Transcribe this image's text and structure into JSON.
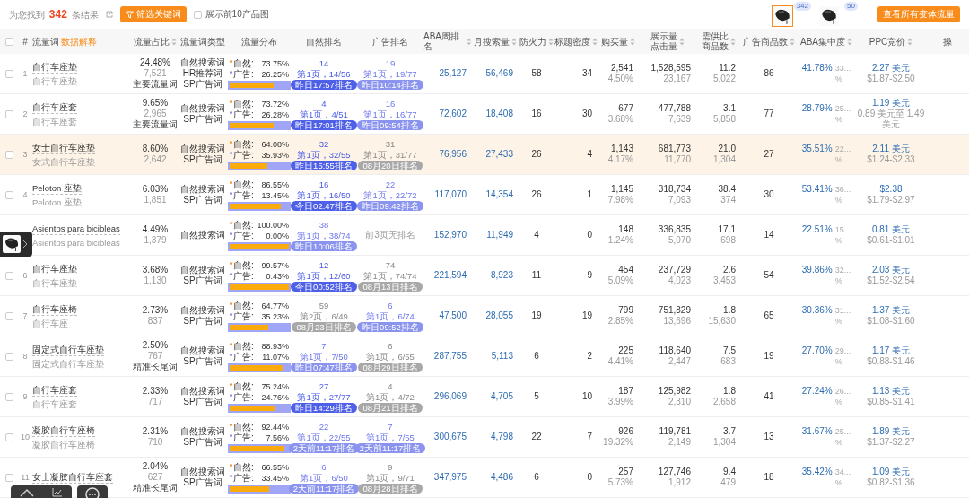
{
  "toolbar": {
    "result_text": "为您找到 **342** 条结果",
    "filter_button": "筛选关键词",
    "show_top10": {
      "label": "展示前10产品图",
      "checked": false
    },
    "variants": [
      {
        "count": "342",
        "selected": true
      },
      {
        "count": "50",
        "selected": false
      }
    ],
    "all_variants_button": "查看所有变体流量"
  },
  "table": {
    "select_all": {
      "checked": false
    },
    "columns": [
      {
        "lines": [
          "#"
        ],
        "sortable": false
      },
      {
        "lines": [
          "流量词"
        ],
        "sortable": false,
        "link": "数据解释"
      },
      {
        "lines": [
          "流量占比"
        ],
        "sortable": true
      },
      {
        "lines": [
          "流量词类型"
        ],
        "sortable": false
      },
      {
        "lines": [
          "流量分布"
        ],
        "sortable": false
      },
      {
        "lines": [
          "自然排名"
        ],
        "sortable": false
      },
      {
        "lines": [
          "广告排名"
        ],
        "sortable": false
      },
      {
        "lines": [
          "ABA周排名"
        ],
        "sortable": true
      },
      {
        "lines": [
          "月搜索量"
        ],
        "sortable": true
      },
      {
        "lines": [
          "防火力"
        ],
        "sortable": true
      },
      {
        "lines": [
          "标题密度"
        ],
        "sortable": true
      },
      {
        "lines": [
          "购买量"
        ],
        "sortable": true
      },
      {
        "lines": [
          "展示量",
          "点击量"
        ],
        "sortable": true
      },
      {
        "lines": [
          "需供比",
          "商品数"
        ],
        "sortable": true
      },
      {
        "lines": [
          "广告商品数"
        ],
        "sortable": true
      },
      {
        "lines": [
          "ABA集中度"
        ],
        "sortable": true
      },
      {
        "lines": [
          "PPC竞价"
        ],
        "sortable": true
      },
      {
        "lines": [
          "操"
        ],
        "sortable": false
      }
    ],
    "rows": [
      {
        "index": "1",
        "checked": false,
        "highlighted": false,
        "keyword": "自行车座垫",
        "translation": "自行车座垫",
        "share": "24.48%",
        "clicks": "7,521",
        "tag": "主要流量词",
        "types": [
          "自然搜索词",
          "HR推荐词",
          "SP广告词"
        ],
        "distribution": [
          {
            "label": "自然:",
            "value": "73.75%"
          },
          {
            "label": "广告:",
            "value": "26.25%"
          }
        ],
        "bar": {
          "level": 0.7375
        },
        "organic_rank": {
          "kind": "ranked",
          "fresh": true,
          "expired": false,
          "rank": "14",
          "page": "第1页，14/56",
          "time": "昨日17:57排名"
        },
        "ad_rank": {
          "kind": "ranked",
          "fresh": false,
          "expired": false,
          "rank": "19",
          "page": "第1页，19/77",
          "time": "昨日10:14排名"
        },
        "aba": "25,127",
        "monthly": "56,469",
        "fire": "58",
        "density": "34",
        "purchase": "2,541",
        "purchase_rate": "4.50%",
        "impressions": "1,528,595",
        "click_count": "23,167",
        "ratio": "11.2",
        "products": "5,022",
        "ad_products": "86",
        "concentration": "41.78%",
        "concentration_cut": "33...",
        "concentration_unit": "%",
        "ppc": "2.27 美元",
        "ppc_range": "$1.87-$2.50"
      },
      {
        "index": "2",
        "checked": false,
        "highlighted": false,
        "keyword": "自行车座套",
        "translation": "自行车座套",
        "share": "9.65%",
        "clicks": "2,965",
        "tag": "主要流量词",
        "types": [
          "自然搜索词",
          "SP广告词"
        ],
        "distribution": [
          {
            "label": "自然:",
            "value": "73.72%"
          },
          {
            "label": "广告:",
            "value": "26.28%"
          }
        ],
        "bar": {
          "level": 0.7372
        },
        "organic_rank": {
          "kind": "ranked",
          "fresh": true,
          "expired": false,
          "rank": "4",
          "page": "第1页，4/51",
          "time": "昨日17:01排名"
        },
        "ad_rank": {
          "kind": "ranked",
          "fresh": false,
          "expired": false,
          "rank": "16",
          "page": "第1页，16/77",
          "time": "昨日09:54排名"
        },
        "aba": "72,602",
        "monthly": "18,408",
        "fire": "16",
        "density": "30",
        "purchase": "677",
        "purchase_rate": "3.68%",
        "impressions": "477,788",
        "click_count": "7,639",
        "ratio": "3.1",
        "products": "5,858",
        "ad_products": "77",
        "concentration": "28.79%",
        "concentration_cut": "25...",
        "concentration_unit": "%",
        "ppc": "1.19 美元",
        "ppc_range": "0.89 美元至 1.49 美元"
      },
      {
        "index": "3",
        "checked": false,
        "highlighted": true,
        "keyword": "女士自行车座垫",
        "translation": "女式自行车座垫",
        "share": "8.60%",
        "clicks": "2,642",
        "types": [
          "自然搜索词",
          "SP广告词"
        ],
        "distribution": [
          {
            "label": "自然:",
            "value": "64.08%"
          },
          {
            "label": "广告:",
            "value": "35.93%"
          }
        ],
        "bar": {
          "level": 0.6408
        },
        "organic_rank": {
          "kind": "ranked",
          "fresh": true,
          "expired": false,
          "rank": "32",
          "page": "第1页，32/55",
          "time": "昨日15:55排名"
        },
        "ad_rank": {
          "kind": "ranked",
          "fresh": false,
          "expired": true,
          "rank": "31",
          "page": "第1页，31/77",
          "time": "08月20日排名"
        },
        "aba": "76,956",
        "monthly": "27,433",
        "fire": "26",
        "density": "4",
        "purchase": "1,143",
        "purchase_rate": "4.17%",
        "impressions": "681,773",
        "click_count": "11,770",
        "ratio": "21.0",
        "products": "1,304",
        "ad_products": "27",
        "concentration": "35.51%",
        "concentration_cut": "22...",
        "concentration_unit": "%",
        "ppc": "2.11 美元",
        "ppc_range": "$1.24-$2.33"
      },
      {
        "index": "4",
        "checked": false,
        "highlighted": false,
        "keyword": "Peloton 座垫",
        "translation": "Peloton 座垫",
        "share": "6.03%",
        "clicks": "1,851",
        "types": [
          "自然搜索词",
          "SP广告词"
        ],
        "distribution": [
          {
            "label": "自然:",
            "value": "86.55%"
          },
          {
            "label": "广告:",
            "value": "13.45%"
          }
        ],
        "bar": {
          "level": 0.8655
        },
        "organic_rank": {
          "kind": "ranked",
          "fresh": true,
          "expired": false,
          "rank": "16",
          "page": "第1页，16/50",
          "time": "今日02:47排名"
        },
        "ad_rank": {
          "kind": "ranked",
          "fresh": false,
          "expired": false,
          "rank": "22",
          "page": "第1页，22/72",
          "time": "昨日09:42排名"
        },
        "aba": "117,070",
        "monthly": "14,354",
        "fire": "26",
        "density": "1",
        "purchase": "1,145",
        "purchase_rate": "7.98%",
        "impressions": "318,734",
        "click_count": "7,093",
        "ratio": "38.4",
        "products": "374",
        "ad_products": "30",
        "concentration": "53.41%",
        "concentration_cut": "36...",
        "concentration_unit": "%",
        "ppc": "$2.38",
        "ppc_range": "$1.79-$2.97"
      },
      {
        "highlighted": false,
        "keyword": "Asientos para bicibleas",
        "translation": "Asientos para bicibleas",
        "share": "4.49%",
        "clicks": "1,379",
        "types": [
          "自然搜索词"
        ],
        "distribution": [
          {
            "label": "自然:",
            "value": "100.00%"
          },
          {
            "label": "广告:",
            "value": "0.00%"
          }
        ],
        "bar": {
          "level": 1
        },
        "organic_rank": {
          "kind": "ranked",
          "fresh": false,
          "expired": false,
          "rank": "38",
          "page": "第1页，38/74",
          "time": "昨日10:06排名"
        },
        "ad_rank": {
          "kind": "unranked",
          "note": "前3页无排名"
        },
        "aba": "152,970",
        "monthly": "11,949",
        "fire": "4",
        "density": "0",
        "purchase": "148",
        "purchase_rate": "1.24%",
        "impressions": "336,835",
        "click_count": "5,070",
        "ratio": "17.1",
        "products": "698",
        "ad_products": "14",
        "concentration": "22.51%",
        "concentration_cut": "15...",
        "concentration_unit": "%",
        "ppc": "0.81 美元",
        "ppc_range": "$0.61-$1.01"
      },
      {
        "index": "6",
        "checked": false,
        "highlighted": false,
        "keyword": "自行车座垫",
        "translation": "自行车座垫",
        "share": "3.68%",
        "clicks": "1,130",
        "types": [
          "自然搜索词",
          "SP广告词"
        ],
        "distribution": [
          {
            "label": "自然:",
            "value": "99.57%"
          },
          {
            "label": "广告:",
            "value": "0.43%"
          }
        ],
        "bar": {
          "level": 0.9957
        },
        "organic_rank": {
          "kind": "ranked",
          "fresh": true,
          "expired": false,
          "rank": "12",
          "page": "第1页，12/60",
          "time": "今日00:52排名"
        },
        "ad_rank": {
          "kind": "ranked",
          "fresh": false,
          "expired": true,
          "rank": "74",
          "page": "第1页，74/74",
          "time": "08月13日排名"
        },
        "aba": "221,594",
        "monthly": "8,923",
        "fire": "11",
        "density": "9",
        "purchase": "454",
        "purchase_rate": "5.09%",
        "impressions": "237,729",
        "click_count": "4,023",
        "ratio": "2.6",
        "products": "3,453",
        "ad_products": "54",
        "concentration": "39.86%",
        "concentration_cut": "32...",
        "concentration_unit": "%",
        "ppc": "2.03 美元",
        "ppc_range": "$1.52-$2.54"
      },
      {
        "index": "7",
        "checked": false,
        "highlighted": false,
        "keyword": "自行车座椅",
        "translation": "自行车座",
        "share": "2.73%",
        "clicks": "837",
        "types": [
          "自然搜索词",
          "SP广告词"
        ],
        "distribution": [
          {
            "label": "自然:",
            "value": "64.77%"
          },
          {
            "label": "广告:",
            "value": "35.23%"
          }
        ],
        "bar": {
          "level": 0.6477
        },
        "organic_rank": {
          "kind": "ranked",
          "fresh": false,
          "expired": true,
          "rank": "59",
          "page": "第2页，6/49",
          "time": "08月23日排名"
        },
        "ad_rank": {
          "kind": "ranked",
          "fresh": false,
          "expired": false,
          "rank": "6",
          "page": "第1页，6/74",
          "time": "昨日09:52排名"
        },
        "aba": "47,500",
        "monthly": "28,055",
        "fire": "19",
        "density": "19",
        "purchase": "799",
        "purchase_rate": "2.85%",
        "impressions": "751,829",
        "click_count": "13,696",
        "ratio": "1.8",
        "products": "15,630",
        "ad_products": "65",
        "concentration": "30.36%",
        "concentration_cut": "31...",
        "concentration_unit": "%",
        "ppc": "1.37 美元",
        "ppc_range": "$1.08-$1.60"
      },
      {
        "index": "8",
        "checked": false,
        "highlighted": false,
        "keyword": "固定式自行车座垫",
        "translation": "固定式自行车座垫",
        "share": "2.50%",
        "clicks": "767",
        "tag": "精准长尾词",
        "types": [
          "自然搜索词",
          "SP广告词"
        ],
        "distribution": [
          {
            "label": "自然:",
            "value": "88.93%"
          },
          {
            "label": "广告:",
            "value": "11.07%"
          }
        ],
        "bar": {
          "level": 0.8893
        },
        "organic_rank": {
          "kind": "ranked",
          "fresh": false,
          "expired": false,
          "rank": "7",
          "page": "第1页，7/50",
          "time": "昨日07:47排名"
        },
        "ad_rank": {
          "kind": "ranked",
          "fresh": false,
          "expired": true,
          "rank": "6",
          "page": "第1页，6/55",
          "time": "08月29日排名"
        },
        "aba": "287,755",
        "monthly": "5,113",
        "fire": "6",
        "density": "2",
        "purchase": "225",
        "purchase_rate": "4.41%",
        "impressions": "118,640",
        "click_count": "2,447",
        "ratio": "7.5",
        "products": "683",
        "ad_products": "19",
        "concentration": "27.70%",
        "concentration_cut": "29...",
        "concentration_unit": "%",
        "ppc": "1.17 美元",
        "ppc_range": "$0.88-$1.46"
      },
      {
        "index": "9",
        "checked": false,
        "highlighted": false,
        "keyword": "自行车座套",
        "translation": "自行车座套",
        "share": "2.33%",
        "clicks": "717",
        "types": [
          "自然搜索词",
          "SP广告词"
        ],
        "distribution": [
          {
            "label": "自然:",
            "value": "75.24%"
          },
          {
            "label": "广告:",
            "value": "24.76%"
          }
        ],
        "bar": {
          "level": 0.7524
        },
        "organic_rank": {
          "kind": "ranked",
          "fresh": true,
          "expired": false,
          "rank": "27",
          "page": "第1页，27/77",
          "time": "昨日14:29排名"
        },
        "ad_rank": {
          "kind": "ranked",
          "fresh": false,
          "expired": true,
          "rank": "4",
          "page": "第1页，4/72",
          "time": "08月21日排名"
        },
        "aba": "296,069",
        "monthly": "4,705",
        "fire": "5",
        "density": "10",
        "purchase": "187",
        "purchase_rate": "3.99%",
        "impressions": "125,982",
        "click_count": "2,310",
        "ratio": "1.8",
        "products": "2,658",
        "ad_products": "41",
        "concentration": "27.24%",
        "concentration_cut": "26...",
        "concentration_unit": "%",
        "ppc": "1.13 美元",
        "ppc_range": "$0.85-$1.41"
      },
      {
        "index": "10",
        "checked": false,
        "highlighted": false,
        "keyword": "凝胶自行车座椅",
        "translation": "凝胶自行车座椅",
        "share": "2.31%",
        "clicks": "710",
        "types": [
          "自然搜索词",
          "SP广告词"
        ],
        "distribution": [
          {
            "label": "自然:",
            "value": "92.44%"
          },
          {
            "label": "广告:",
            "value": "7.56%"
          }
        ],
        "bar": {
          "level": 0.9244
        },
        "organic_rank": {
          "kind": "ranked",
          "fresh": false,
          "expired": false,
          "rank": "22",
          "page": "第1页，22/55",
          "time": "2天前11:17排名"
        },
        "ad_rank": {
          "kind": "ranked",
          "fresh": false,
          "expired": false,
          "rank": "7",
          "page": "第1页，7/55",
          "time": "2天前11:17排名"
        },
        "aba": "300,675",
        "monthly": "4,798",
        "fire": "22",
        "density": "7",
        "purchase": "926",
        "purchase_rate": "19.32%",
        "impressions": "119,781",
        "click_count": "2,149",
        "ratio": "3.7",
        "products": "1,304",
        "ad_products": "13",
        "concentration": "31.67%",
        "concentration_cut": "25...",
        "concentration_unit": "%",
        "ppc": "1.89 美元",
        "ppc_range": "$1.37-$2.27"
      },
      {
        "index": "11",
        "checked": false,
        "highlighted": false,
        "keyword": "女士凝胶自行车座套",
        "share": "2.04%",
        "clicks": "627",
        "tag": "精准长尾词",
        "types": [
          "自然搜索词",
          "SP广告词"
        ],
        "distribution": [
          {
            "label": "自然:",
            "value": "66.55%"
          },
          {
            "label": "广告:",
            "value": "33.45%"
          }
        ],
        "bar": {
          "level": 0.6655
        },
        "organic_rank": {
          "kind": "ranked",
          "fresh": false,
          "expired": false,
          "rank": "6",
          "page": "第1页，6/50",
          "time": "2天前11:17排名"
        },
        "ad_rank": {
          "kind": "ranked",
          "fresh": false,
          "expired": true,
          "rank": "9",
          "page": "第1页，9/71",
          "time": "08月28日排名"
        },
        "aba": "347,975",
        "monthly": "4,486",
        "fire": "6",
        "density": "0",
        "purchase": "257",
        "purchase_rate": "5.73%",
        "impressions": "127,746",
        "click_count": "1,912",
        "ratio": "9.4",
        "products": "479",
        "ad_products": "18",
        "concentration": "35.42%",
        "concentration_cut": "34...",
        "concentration_unit": "%",
        "ppc": "1.09 美元",
        "ppc_range": "$0.82-$1.36"
      }
    ]
  }
}
